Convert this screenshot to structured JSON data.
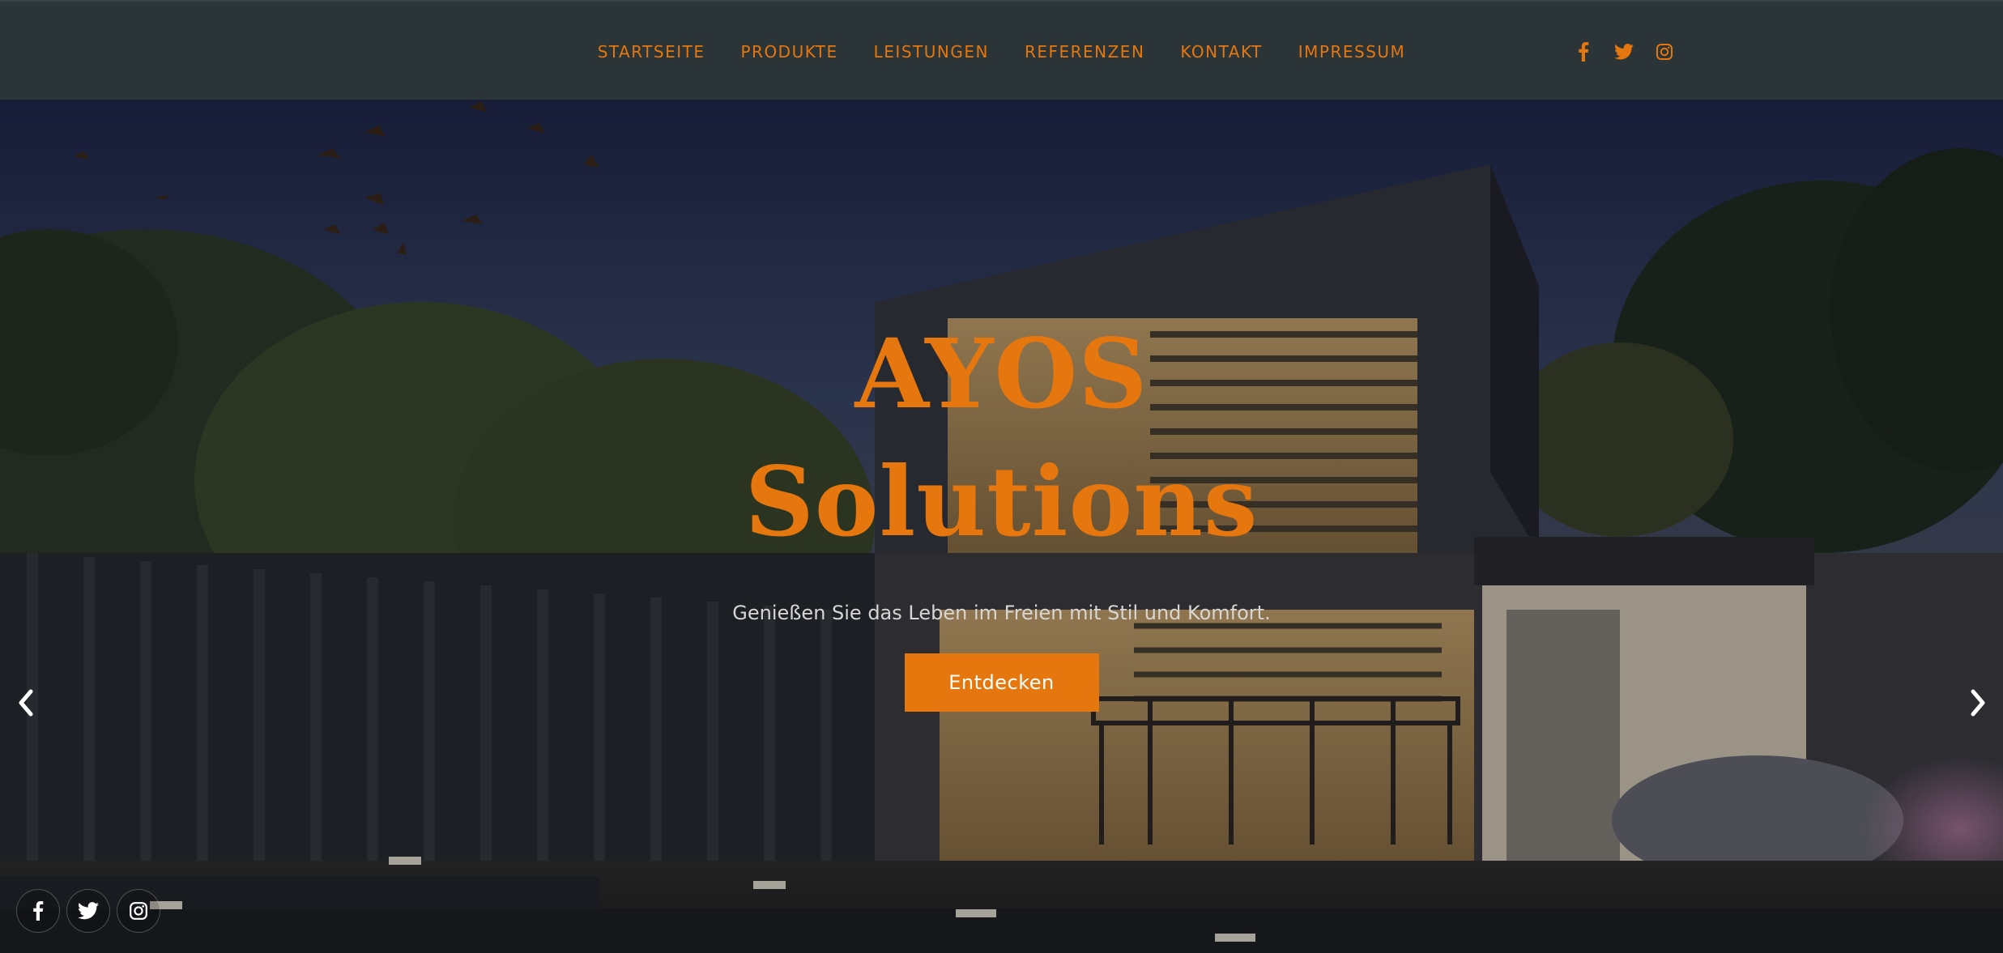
{
  "nav": {
    "items": [
      {
        "label": "STARTSEITE"
      },
      {
        "label": "PRODUKTE"
      },
      {
        "label": "LEISTUNGEN"
      },
      {
        "label": "REFERENZEN"
      },
      {
        "label": "KONTAKT"
      },
      {
        "label": "IMPRESSUM"
      }
    ],
    "social_icons": [
      "facebook-icon",
      "twitter-icon",
      "instagram-icon"
    ]
  },
  "hero": {
    "title_line1": "AYOS",
    "title_line2": "Solutions",
    "subtitle": "Genießen Sie das Leben im Freien mit Stil und Komfort.",
    "button_label": "Entdecken",
    "prev_icon": "chevron-left-icon",
    "next_icon": "chevron-right-icon"
  },
  "bottom_social": {
    "icons": [
      "facebook-icon",
      "twitter-icon",
      "instagram-icon"
    ]
  },
  "colors": {
    "accent": "#e6760e",
    "navbar_bg": "#2b3436",
    "subtitle_text": "#d8d6d2",
    "button_text": "#ffffff"
  }
}
